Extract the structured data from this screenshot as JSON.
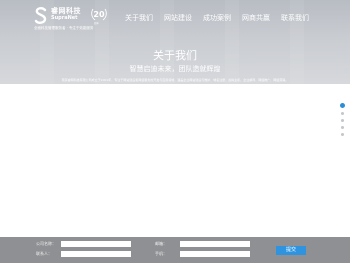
{
  "header": {
    "logo_cn": "睿网科技",
    "logo_en": "SupraNet",
    "logo_badge": "20",
    "logo_badge_sub": "周年",
    "logo_slogan": "全面科技管理服务者 · 专注于效能服务"
  },
  "nav": {
    "items": [
      {
        "label": "关于我们"
      },
      {
        "label": "网站建设"
      },
      {
        "label": "成功案例"
      },
      {
        "label": "网商共赢"
      },
      {
        "label": "联系我们"
      }
    ]
  },
  "hero": {
    "title": "关于我们",
    "subtitle": "智慧启迪未来，团队造就辉煌",
    "description": "南京睿网科技有限公司成立于2001年，专注于网站建设和网络服务的开发与应用领域，涵盖企业网站建设与维护、域名注册、虚拟主机、企业邮局、网络推广、网络营销。"
  },
  "pager": {
    "count": 5,
    "active_index": 0
  },
  "form": {
    "company_label": "公司名称：",
    "email_label": "邮箱：",
    "contact_label": "联系人：",
    "phone_label": "手机：",
    "submit_label": "提交"
  },
  "colors": {
    "accent": "#2f94e0",
    "form_bg": "#8f9093"
  }
}
